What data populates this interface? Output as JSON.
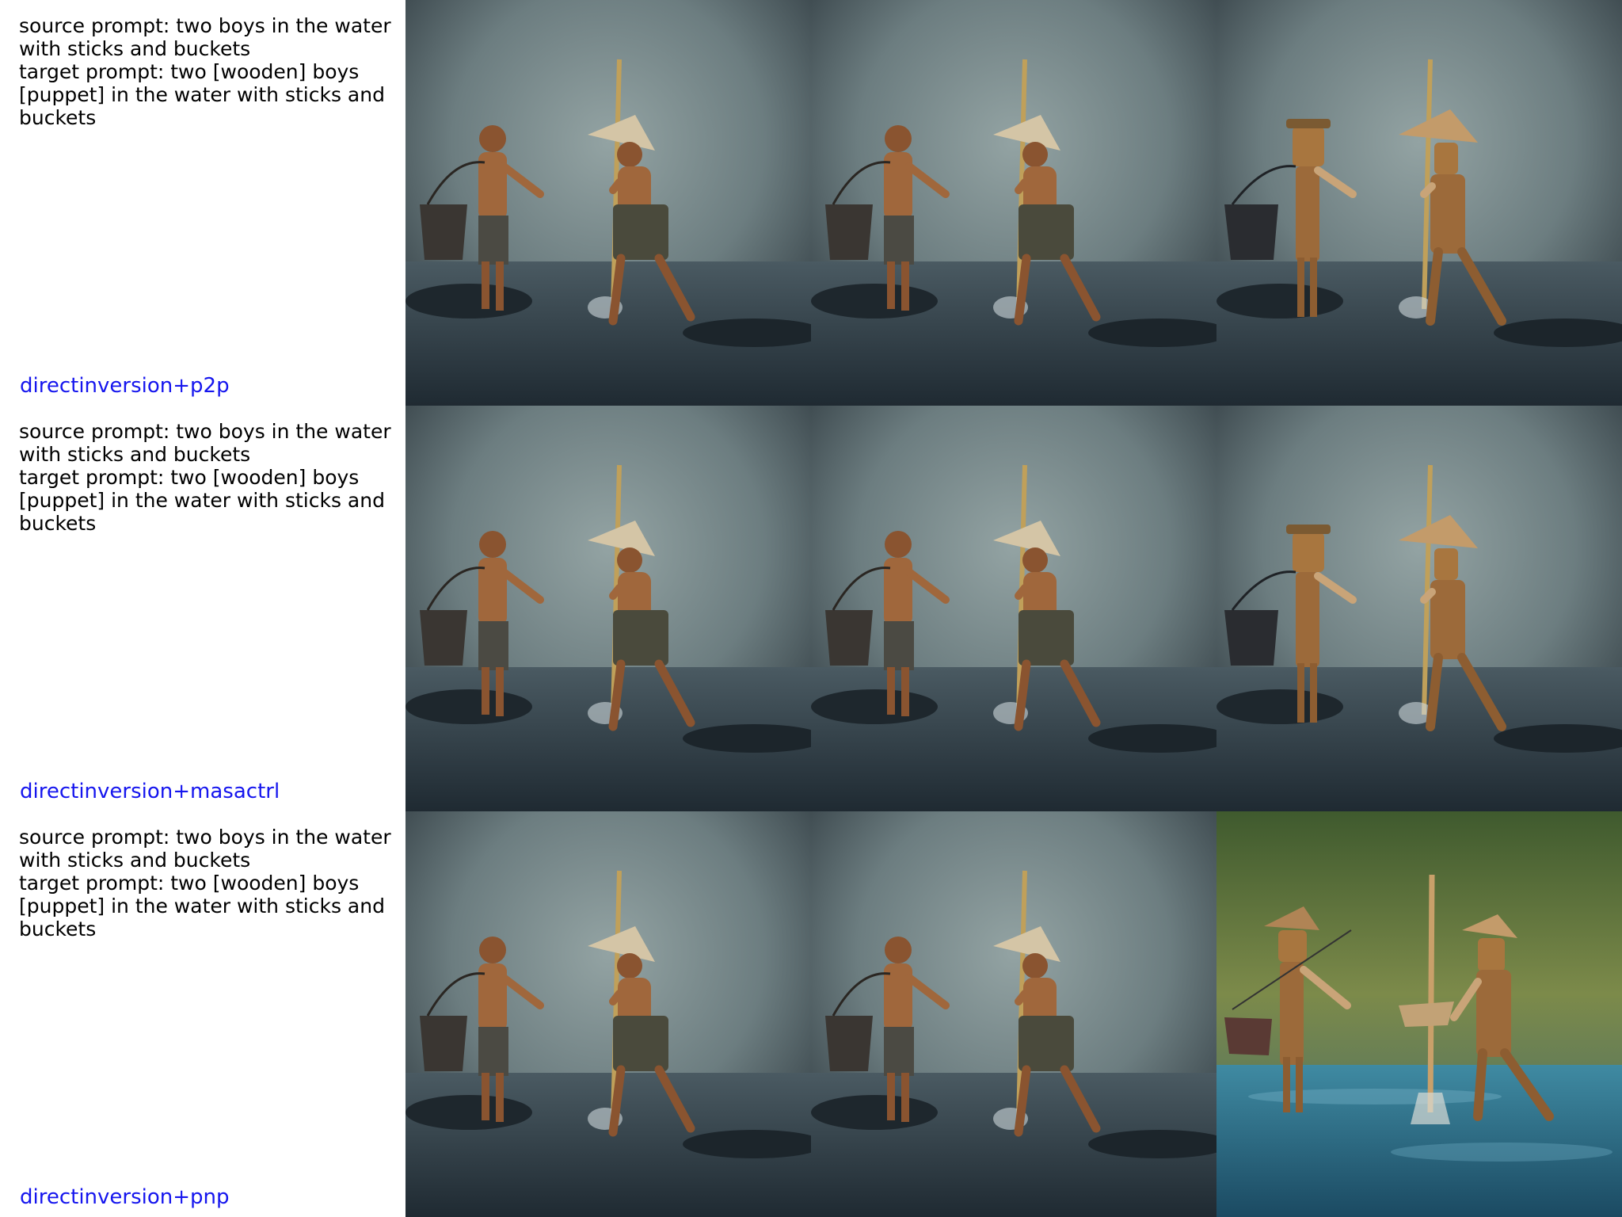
{
  "rows": [
    {
      "source_prompt": "source prompt: two boys in the water with sticks and buckets",
      "target_prompt": "target prompt: two [wooden] boys [puppet] in the water with sticks and buckets",
      "method": "directinversion+p2p"
    },
    {
      "source_prompt": "source prompt: two boys in the water with sticks and buckets",
      "target_prompt": "target prompt: two [wooden] boys [puppet] in the water with sticks and buckets",
      "method": "directinversion+masactrl"
    },
    {
      "source_prompt": "source prompt: two boys in the water with sticks and buckets",
      "target_prompt": "target prompt: two [wooden] boys [puppet] in the water with sticks and buckets",
      "method": "directinversion+pnp"
    }
  ],
  "colors": {
    "method_label": "#1515ee",
    "fog_bg": "#6f8084",
    "water": "#2d3a42",
    "skin": "#a0673c",
    "wood": "#9c6a3a",
    "pnp_water": "#2b6c86",
    "pnp_foliage": "#5d7a3a"
  }
}
